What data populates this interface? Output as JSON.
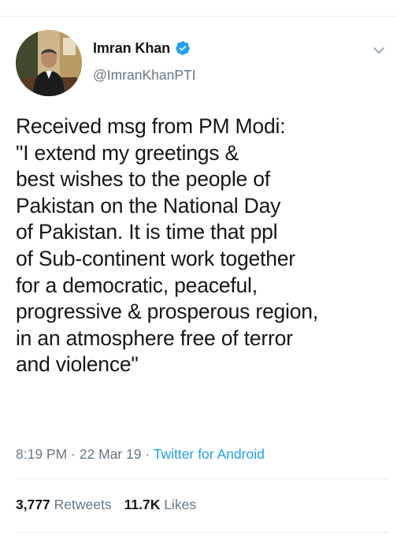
{
  "tweet": {
    "author": {
      "display_name": "Imran Khan",
      "handle": "@ImranKhanPTI",
      "verified": true,
      "avatar_icon": "profile-photo"
    },
    "text_lines": [
      "Received msg from PM Modi:",
      "\"I extend my greetings &",
      "best wishes to the people of",
      "Pakistan on the National Day",
      "of Pakistan. It is time that ppl",
      "of Sub-continent work together",
      "for a democratic, peaceful,",
      "progressive & prosperous region,",
      "in an atmosphere free of terror",
      "and violence\""
    ],
    "meta": {
      "time": "8:19 PM",
      "separator": " · ",
      "date": "22 Mar 19",
      "source": "Twitter for Android"
    },
    "stats": {
      "retweets_count": "3,777",
      "retweets_label": "Retweets",
      "likes_count": "11.7K",
      "likes_label": "Likes"
    }
  },
  "colors": {
    "text_primary": "#14171a",
    "text_secondary": "#657786",
    "accent": "#1da1f2",
    "divider": "#e6ecf0"
  }
}
